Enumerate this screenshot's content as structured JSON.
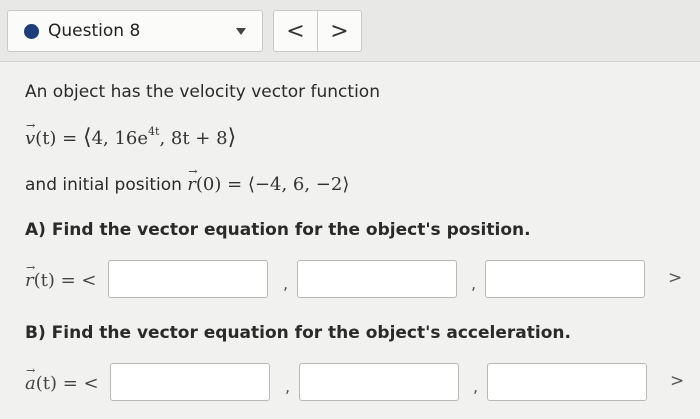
{
  "header": {
    "question_label": "Question 8",
    "prev_label": "<",
    "next_label": ">"
  },
  "prompt": {
    "intro": "An object has the velocity vector function",
    "velocity": {
      "lhs": "(t) = ",
      "vec_letter": "v",
      "open": "⟨",
      "c1": "4, 16e",
      "exp": "4t",
      "c2": ", 8t + 8",
      "close": "⟩"
    },
    "initial_text": "and initial position ",
    "initial": {
      "vec_letter": "r",
      "expr": "(0) = ⟨−4, 6, −2⟩"
    },
    "part_a": "A) Find the vector equation for the object's position.",
    "part_b": "B) Find the vector equation for the object's acceleration."
  },
  "position_row": {
    "vec_letter": "r",
    "label": "(t) = <",
    "values": [
      "",
      "",
      ""
    ],
    "comma": ",",
    "close": ">"
  },
  "acceleration_row": {
    "vec_letter": "a",
    "label": "(t) = <",
    "values": [
      "",
      "",
      ""
    ],
    "comma": ",",
    "close": ">"
  },
  "colors": {
    "status_dot": "#1f3d78",
    "background": "#f1f1ef"
  }
}
